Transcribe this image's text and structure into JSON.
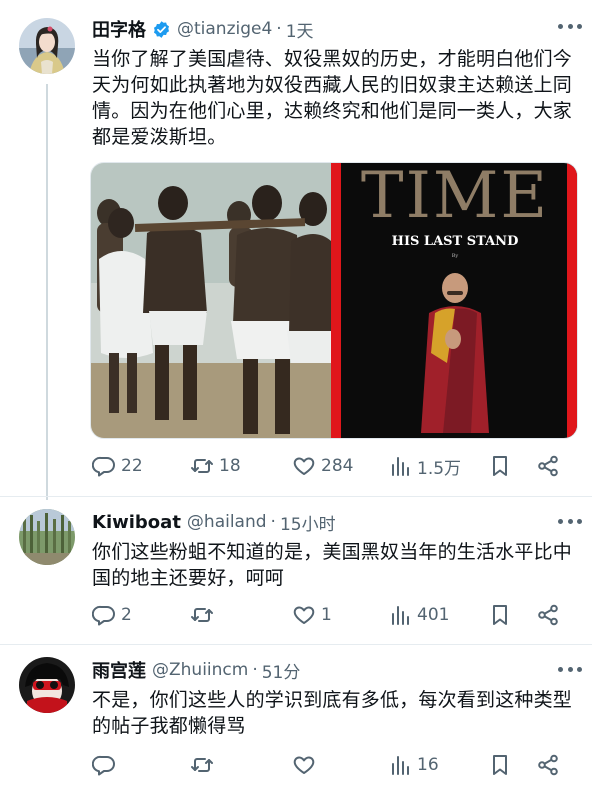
{
  "posts": [
    {
      "name": "田字格",
      "verified": true,
      "handle": "@tianzige4",
      "time": "1天",
      "text": "当你了解了美国虐待、奴役黑奴的历史，才能明白他们今天为何如此执著地为奴役西藏人民的旧奴隶主达赖送上同情。因为在他们心里，达赖终究和他们是同一类人，大家都是爱泼斯坦。",
      "media": {
        "magazine_title": "TIME",
        "cover_headline": "HIS LAST STAND",
        "cover_byline": "By"
      },
      "stats": {
        "replies": "22",
        "retweets": "18",
        "likes": "284",
        "views": "1.5万"
      }
    },
    {
      "name": "Kiwiboat",
      "handle": "@hailand",
      "time": "15小时",
      "text": "你们这些粉蛆不知道的是，美国黑奴当年的生活水平比中国的地主还要好，呵呵",
      "stats": {
        "replies": "2",
        "retweets": "",
        "likes": "1",
        "views": "401"
      }
    },
    {
      "name": "雨宫莲",
      "handle": "@Zhuiincm",
      "time": "51分",
      "text": "不是，你们这些人的学识到底有多低，每次看到这种类型的帖子我都懒得骂",
      "stats": {
        "replies": "",
        "retweets": "",
        "likes": "",
        "views": "16"
      }
    }
  ],
  "colors": {
    "text": "#0f1419",
    "secondary": "#536471",
    "verified_blue": "#1d9bf0",
    "time_red": "#e0161b",
    "divider": "#e6ecf0"
  },
  "icons": [
    "reply-icon",
    "retweet-icon",
    "like-icon",
    "views-icon",
    "bookmark-icon",
    "share-icon",
    "more-icon",
    "verified-icon"
  ]
}
